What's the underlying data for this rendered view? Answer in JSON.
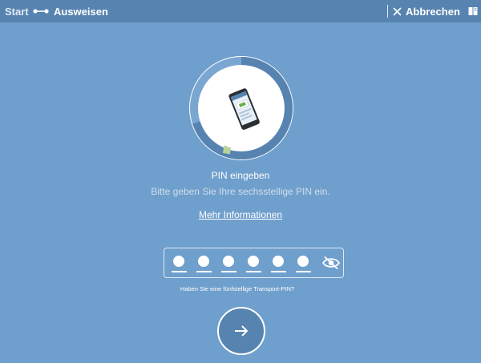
{
  "topbar": {
    "start": "Start",
    "current": "Ausweisen",
    "cancel_label": "Abbrechen"
  },
  "main": {
    "title": "PIN eingeben",
    "subtitle": "Bitte geben Sie Ihre sechsstellige PIN ein.",
    "more_info": "Mehr Informationen",
    "transport_pin_hint": "Haben Sie eine fünfstellige Transport-PIN?"
  },
  "pin": {
    "digits_entered": 6,
    "digits_total": 6
  },
  "progress": {
    "fraction": 0.7
  },
  "colors": {
    "background": "#6f9fcc",
    "topbar": "#5783b0",
    "ring_progress": "#5783b0",
    "ring_track": "#7aa6d2",
    "ring_marker": "#b9d39a",
    "button": "#5783b0"
  }
}
